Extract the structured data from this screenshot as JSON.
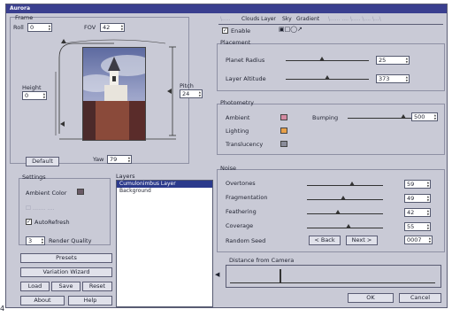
{
  "window": {
    "title": "Aurora"
  },
  "frame": {
    "title": "Frame",
    "roll_label": "Roll",
    "roll_value": "0",
    "fov_label": "FOV",
    "fov_value": "42",
    "height_label": "Height",
    "height_value": "0",
    "pitch_label": "Pitch",
    "pitch_value": "24",
    "yaw_label": "Yaw",
    "yaw_value": "79",
    "default_button": "Default"
  },
  "settings": {
    "title": "Settings",
    "ambient_label": "Ambient Color",
    "ambient_color": "#6a5a66",
    "autorefresh_label": "AutoRefresh",
    "autorefresh_checked": true,
    "render_value": "3",
    "render_label": "Render Quality",
    "presets_button": "Presets",
    "variation_button": "Variation Wizard",
    "load_button": "Load",
    "save_button": "Save",
    "reset_button": "Reset",
    "about_button": "About",
    "help_button": "Help"
  },
  "layers": {
    "title": "Layers",
    "items": [
      "Cumulonimbus Layer",
      "Background"
    ]
  },
  "tabs": [
    "Clouds Layer",
    "Sky",
    "Gradient"
  ],
  "enable_label": "Enable",
  "enable_checked": true,
  "placement": {
    "title": "Placement",
    "planet_radius_label": "Planet Radius",
    "planet_radius_value": "25",
    "planet_radius_level": 0.45,
    "layer_altitude_label": "Layer Altitude",
    "layer_altitude_value": "373",
    "layer_altitude_level": 0.5
  },
  "photometry": {
    "title": "Photometry",
    "ambient_label": "Ambient",
    "ambient_color": "#d48aa2",
    "lighting_label": "Lighting",
    "lighting_color": "#e8a04a",
    "translucency_label": "Translucency",
    "translucency_color": "#8a8c9a",
    "bumping_label": "Bumping",
    "bumping_value": "500",
    "bumping_level": 0.95
  },
  "noise": {
    "title": "Noise",
    "overtones_label": "Overtones",
    "overtones_value": "59",
    "overtones_level": 0.59,
    "fragmentation_label": "Fragmentation",
    "fragmentation_value": "49",
    "fragmentation_level": 0.49,
    "feathering_label": "Feathering",
    "feathering_value": "42",
    "feathering_level": 0.42,
    "coverage_label": "Coverage",
    "coverage_value": "55",
    "coverage_level": 0.55,
    "random_seed_label": "Random Seed",
    "back_button": "< Back",
    "next_button": "Next >",
    "random_seed_value": "0007"
  },
  "distance": {
    "title": "Distance from Camera"
  },
  "ok_button": "OK",
  "cancel_button": "Cancel",
  "footnote": "4"
}
